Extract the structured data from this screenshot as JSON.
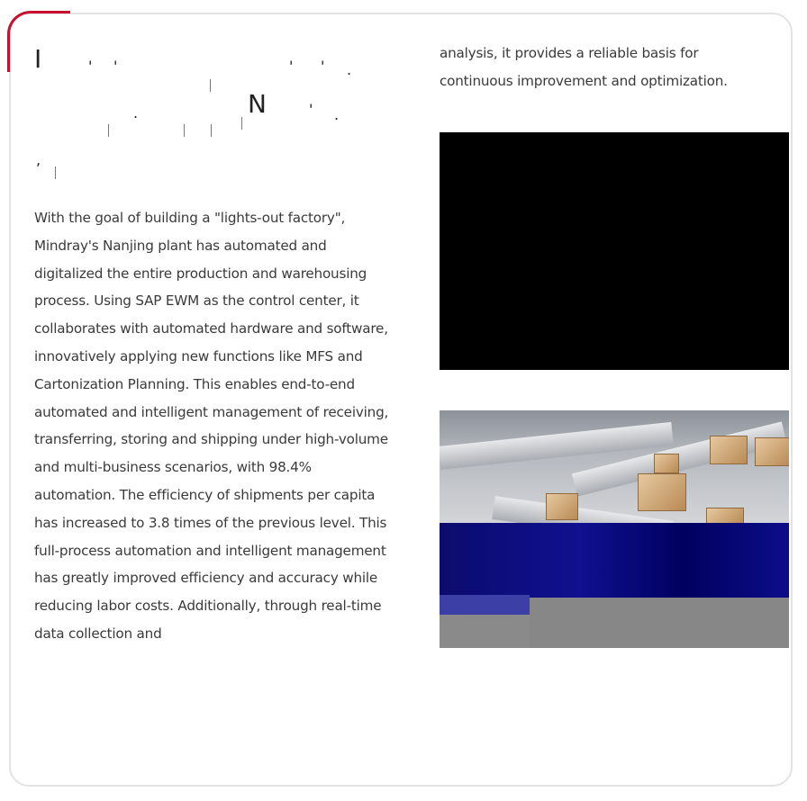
{
  "title_glyphs": {
    "char1": "I",
    "char2": "N"
  },
  "left_paragraph": "With the goal of building a \"lights-out factory\", Mindray's Nanjing plant has automated and digitalized the entire production and warehousing process. Using SAP EWM as the control center, it collaborates with automated hardware and software, innovatively applying new functions like MFS and Cartonization Planning. This enables end-to-end automated and intelligent management of receiving, transferring, storing and shipping under high-volume and multi-business scenarios, with 98.4% automation. The efficiency of shipments per capita has increased to 3.8 times of the previous level. This full-process automation and intelligent management has greatly improved efficiency and accuracy while reducing labor costs. Additionally, through real-time data collection and",
  "right_paragraph": "analysis, it provides a reliable basis for continuous improvement and optimization.",
  "colors": {
    "accent": "#c8102e",
    "border": "#e3e3e3",
    "text": "#3a3a3a"
  }
}
